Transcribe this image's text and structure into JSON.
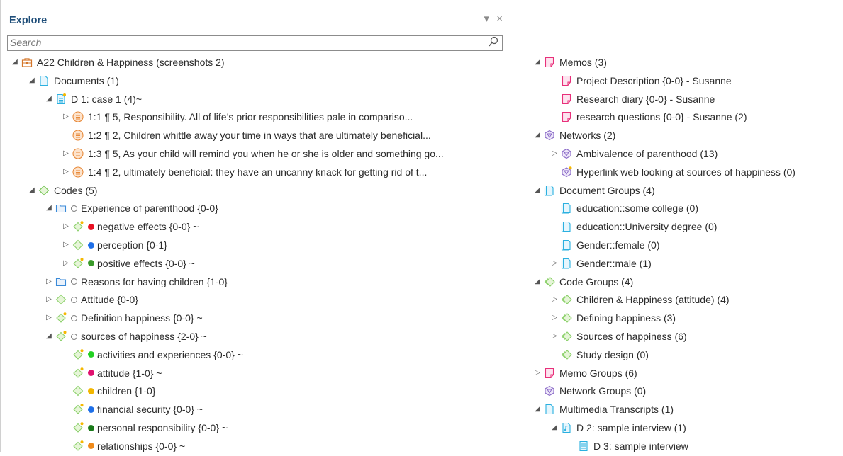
{
  "panel": {
    "title": "Explore",
    "dropdown_icon": "▾",
    "close_icon": "×"
  },
  "search": {
    "placeholder": "Search"
  },
  "left_tree": [
    {
      "level": 0,
      "exp": "◢",
      "icon": "project",
      "label": "A22 Children & Happiness (screenshots 2)"
    },
    {
      "level": 1,
      "exp": "◢",
      "icon": "doc",
      "label": "Documents (1)"
    },
    {
      "level": 2,
      "exp": "◢",
      "icon": "docstar",
      "label": "D 1: case 1 (4)~"
    },
    {
      "level": 3,
      "exp": "▷",
      "icon": "quote",
      "label": "1:1 ¶ 5, Responsibility. All of life’s prior responsibilities pale in compariso..."
    },
    {
      "level": 3,
      "exp": "",
      "icon": "quote",
      "label": "1:2 ¶ 2, Children whittle away your time in ways that are ultimately beneficial..."
    },
    {
      "level": 3,
      "exp": "▷",
      "icon": "quote",
      "label": "1:3 ¶ 5, As your child will remind you when he or she is older and something go..."
    },
    {
      "level": 3,
      "exp": "▷",
      "icon": "quote",
      "label": "1:4 ¶ 2, ultimately beneficial: they have an uncanny knack for getting rid of t..."
    },
    {
      "level": 1,
      "exp": "◢",
      "icon": "codes",
      "label": "Codes (5)"
    },
    {
      "level": 2,
      "exp": "◢",
      "icon": "folder",
      "color": "hollow",
      "label": "Experience of parenthood {0-0}"
    },
    {
      "level": 3,
      "exp": "▷",
      "icon": "codestar",
      "color": "#e81123",
      "label": "negative effects {0-0} ~"
    },
    {
      "level": 3,
      "exp": "▷",
      "icon": "code",
      "color": "#1e6fe8",
      "label": "perception {0-1}"
    },
    {
      "level": 3,
      "exp": "▷",
      "icon": "codestar",
      "color": "#3a9a2a",
      "label": "positive effects {0-0} ~"
    },
    {
      "level": 2,
      "exp": "▷",
      "icon": "folder",
      "color": "hollow",
      "label": "Reasons for having children {1-0}"
    },
    {
      "level": 2,
      "exp": "▷",
      "icon": "code",
      "color": "hollow",
      "label": "Attitude {0-0}"
    },
    {
      "level": 2,
      "exp": "▷",
      "icon": "codestar",
      "color": "hollow",
      "label": "Definition happiness {0-0} ~"
    },
    {
      "level": 2,
      "exp": "◢",
      "icon": "codestar",
      "color": "hollow",
      "label": "sources of happiness {2-0} ~"
    },
    {
      "level": 3,
      "exp": "",
      "icon": "codestar",
      "color": "#22d022",
      "label": "activities and experiences {0-0} ~"
    },
    {
      "level": 3,
      "exp": "",
      "icon": "codestar",
      "color": "#e0106e",
      "label": "attitude {1-0} ~"
    },
    {
      "level": 3,
      "exp": "",
      "icon": "code",
      "color": "#f2b600",
      "label": "children {1-0}"
    },
    {
      "level": 3,
      "exp": "",
      "icon": "codestar",
      "color": "#1e6fe8",
      "label": "financial security {0-0} ~"
    },
    {
      "level": 3,
      "exp": "",
      "icon": "codestar",
      "color": "#1a7a1a",
      "label": "personal responsibility {0-0} ~"
    },
    {
      "level": 3,
      "exp": "",
      "icon": "codestar",
      "color": "#ef8a1a",
      "label": "relationships {0-0} ~"
    }
  ],
  "right_tree": [
    {
      "level": 0,
      "exp": "◢",
      "icon": "memo",
      "label": "Memos (3)"
    },
    {
      "level": 1,
      "exp": "",
      "icon": "memo",
      "label": "Project Description {0-0} - Susanne"
    },
    {
      "level": 1,
      "exp": "",
      "icon": "memo",
      "label": "Research diary {0-0} - Susanne"
    },
    {
      "level": 1,
      "exp": "",
      "icon": "memo",
      "label": "research questions {0-0} - Susanne (2)"
    },
    {
      "level": 0,
      "exp": "◢",
      "icon": "network",
      "label": "Networks (2)"
    },
    {
      "level": 1,
      "exp": "▷",
      "icon": "network",
      "label": "Ambivalence of parenthood (13)"
    },
    {
      "level": 1,
      "exp": "",
      "icon": "networkstar",
      "label": "Hyperlink web looking at sources of happiness (0)"
    },
    {
      "level": 0,
      "exp": "◢",
      "icon": "docgroup",
      "label": "Document Groups (4)"
    },
    {
      "level": 1,
      "exp": "",
      "icon": "docgroup",
      "label": "education::some college (0)"
    },
    {
      "level": 1,
      "exp": "",
      "icon": "docgroup",
      "label": "education::University degree (0)"
    },
    {
      "level": 1,
      "exp": "",
      "icon": "docgroup",
      "label": "Gender::female (0)"
    },
    {
      "level": 1,
      "exp": "▷",
      "icon": "docgroup",
      "label": "Gender::male (1)"
    },
    {
      "level": 0,
      "exp": "◢",
      "icon": "codegroup",
      "label": "Code Groups (4)"
    },
    {
      "level": 1,
      "exp": "▷",
      "icon": "codegroup",
      "label": "Children & Happiness (attitude) (4)"
    },
    {
      "level": 1,
      "exp": "▷",
      "icon": "codegroup",
      "label": "Defining happiness (3)"
    },
    {
      "level": 1,
      "exp": "▷",
      "icon": "codegroup",
      "label": "Sources of happiness (6)"
    },
    {
      "level": 1,
      "exp": "",
      "icon": "codegroup",
      "label": "Study design (0)"
    },
    {
      "level": 0,
      "exp": "▷",
      "icon": "memo",
      "label": "Memo Groups (6)"
    },
    {
      "level": 0,
      "exp": "",
      "icon": "network",
      "label": "Network Groups (0)"
    },
    {
      "level": 0,
      "exp": "◢",
      "icon": "doc",
      "label": "Multimedia Transcripts (1)"
    },
    {
      "level": 1,
      "exp": "◢",
      "icon": "audio",
      "label": "D 2: sample interview (1)"
    },
    {
      "level": 2,
      "exp": "",
      "icon": "transcript",
      "label": "D 3: sample interview"
    }
  ]
}
